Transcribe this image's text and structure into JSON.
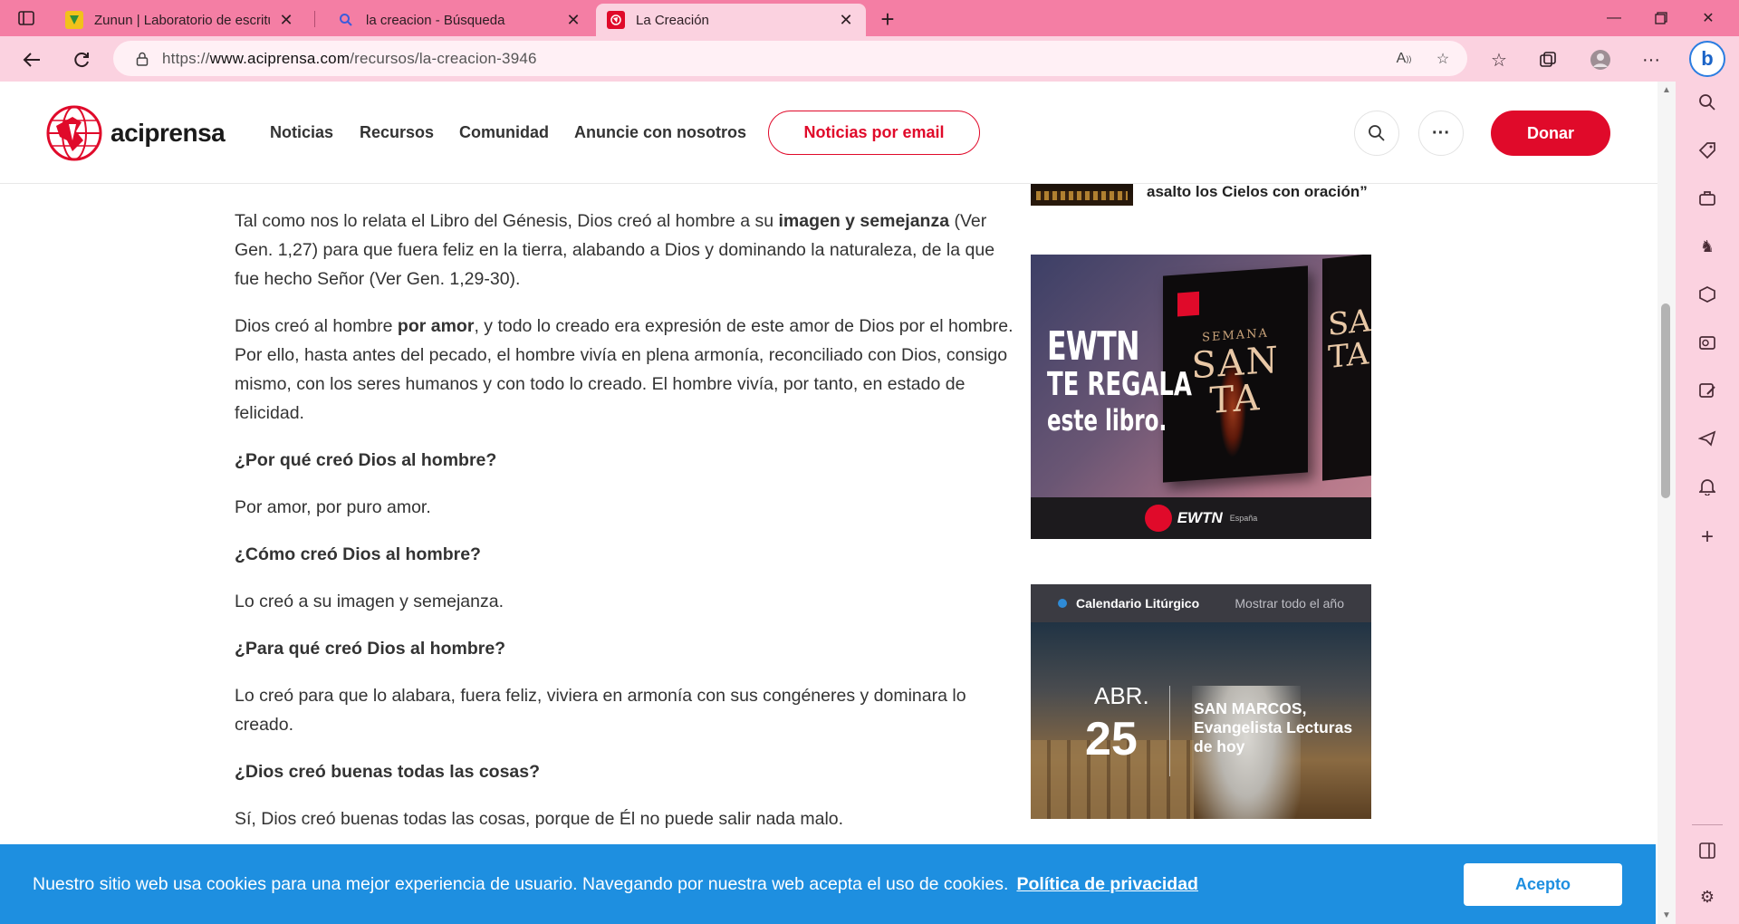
{
  "browser": {
    "tabs": [
      {
        "title": "Zunun | Laboratorio de escritura",
        "icon": "zunun-favicon"
      },
      {
        "title": "la creacion - Búsqueda",
        "icon": "bing-search-favicon"
      },
      {
        "title": "La Creación",
        "icon": "aciprensa-favicon",
        "active": true
      }
    ],
    "url_prefix": "https://",
    "url_domain": "www.aciprensa.com",
    "url_path": "/recursos/la-creacion-3946",
    "bing_label": "b"
  },
  "site": {
    "logo_text": "aciprensa",
    "nav": [
      "Noticias",
      "Recursos",
      "Comunidad",
      "Anuncie con nosotros"
    ],
    "email_button": "Noticias por email",
    "donate_button": "Donar",
    "accent_color": "#e00a2a"
  },
  "article": {
    "p1_a": "Tal como nos lo relata el Libro del Génesis, Dios creó al hombre a su ",
    "p1_b": "imagen y semejanza",
    "p1_c": " (Ver Gen. 1,27) para que fuera feliz en la tierra, alabando a Dios y dominando la naturaleza, de la que fue hecho Señor (Ver Gen. 1,29-30).",
    "p2_a": "Dios creó al hombre ",
    "p2_b": "por amor",
    "p2_c": ", y todo lo creado era expresión de este amor de Dios por el hombre. Por ello, hasta antes del pecado, el hombre vivía en plena armonía, reconciliado con Dios, consigo mismo, con los seres humanos y con todo lo creado. El hombre vivía, por tanto, en estado de felicidad.",
    "q1": "¿Por qué creó Dios al hombre?",
    "a1": "Por amor, por puro amor.",
    "q2": "¿Cómo creó Dios al hombre?",
    "a2": "Lo creó a su imagen y semejanza.",
    "q3": "¿Para qué creó Dios al hombre?",
    "a3": "Lo creó para que lo alabara, fuera feliz, viviera en armonía con sus congéneres y dominara lo creado.",
    "q4": "¿Dios creó buenas todas las cosas?",
    "a4": "Sí, Dios creó buenas todas las cosas, porque de Él no puede salir nada malo."
  },
  "sidebar_content": {
    "prev_title": "asalto los Cielos con oración”",
    "ad": {
      "line1": "EWTN",
      "line2": "TE REGALA",
      "line3": "este libro.",
      "book_top": "SEMANA",
      "book_big": "SAN TA",
      "book2_big": "SA TA",
      "footer_brand": "EWTN",
      "footer_region": "España"
    },
    "calendar": {
      "title": "Calendario Litúrgico",
      "show_all": "Mostrar todo el año",
      "month": "ABR.",
      "day": "25",
      "saint": "SAN MARCOS, Evangelista Lecturas de hoy"
    }
  },
  "cookie": {
    "text": "Nuestro sitio web usa cookies para una mejor experiencia de usuario. Navegando por nuestra web acepta el uso de cookies.",
    "link": "Política de privacidad",
    "accept": "Acepto",
    "color": "#1e8fe0"
  }
}
